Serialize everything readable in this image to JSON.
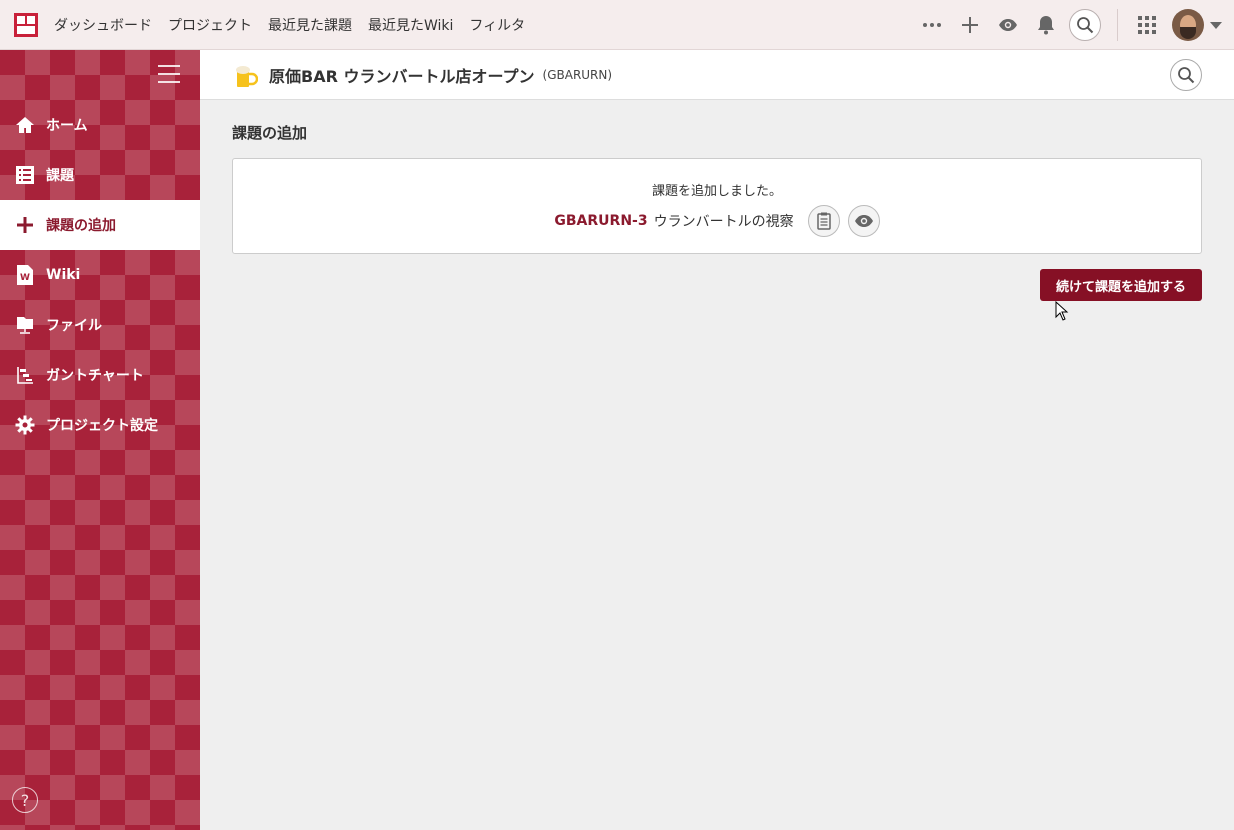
{
  "topbar": {
    "nav": [
      "ダッシュボード",
      "プロジェクト",
      "最近見た課題",
      "最近見たWiki",
      "フィルタ"
    ],
    "icons": [
      "more-icon",
      "plus-icon",
      "eye-icon",
      "bell-icon",
      "search-icon",
      "apps-grid-icon"
    ]
  },
  "sidebar": {
    "items": [
      {
        "label": "ホーム",
        "icon": "home-icon"
      },
      {
        "label": "課題",
        "icon": "list-icon"
      },
      {
        "label": "課題の追加",
        "icon": "plus-icon",
        "active": true
      },
      {
        "label": "Wiki",
        "icon": "wiki-icon"
      },
      {
        "label": "ファイル",
        "icon": "folder-icon"
      },
      {
        "label": "ガントチャート",
        "icon": "gantt-icon"
      },
      {
        "label": "プロジェクト設定",
        "icon": "gear-icon"
      }
    ],
    "help": "?"
  },
  "project": {
    "name": "原価BAR ウランバートル店オープン",
    "key": "(GBARURN)"
  },
  "main": {
    "title": "課題の追加",
    "notice": "課題を追加しました。",
    "issue_key": "GBARURN-3",
    "issue_title": "ウランバートルの視察",
    "continue_button": "続けて課題を追加する"
  },
  "colors": {
    "brand": "#a8223a",
    "accent": "#861025",
    "link": "#8b1a2e"
  }
}
